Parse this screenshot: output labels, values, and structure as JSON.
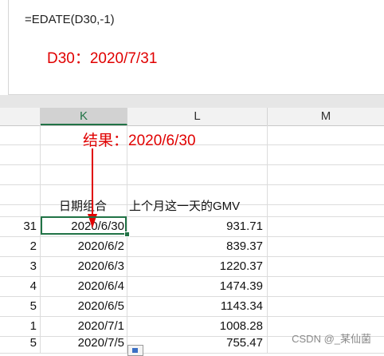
{
  "formula_bar": {
    "text": "=EDATE(D30,-1)"
  },
  "annotations": {
    "d30_note": "D30：2020/7/31",
    "result_note": "结果：2020/6/30"
  },
  "columns": [
    "K",
    "L",
    "M"
  ],
  "selected_column": "K",
  "table": {
    "header": {
      "k": "日期组合",
      "l": "上个月这一天的GMV"
    },
    "rows": [
      {
        "rownum": "31",
        "k": "2020/6/30",
        "l": "931.71"
      },
      {
        "rownum": "2",
        "k": "2020/6/2",
        "l": "839.37"
      },
      {
        "rownum": "3",
        "k": "2020/6/3",
        "l": "1220.37"
      },
      {
        "rownum": "4",
        "k": "2020/6/4",
        "l": "1474.39"
      },
      {
        "rownum": "5",
        "k": "2020/6/5",
        "l": "1143.34"
      },
      {
        "rownum": "1",
        "k": "2020/7/1",
        "l": "1008.28"
      },
      {
        "rownum": "5",
        "k": "2020/7/5",
        "l": "755.47"
      }
    ]
  },
  "watermark": "CSDN @_某仙菌",
  "colors": {
    "annotation": "#e00000",
    "selection": "#217346"
  },
  "icons": {
    "arrow": "down-arrow-icon",
    "paste": "paste-options-icon"
  }
}
